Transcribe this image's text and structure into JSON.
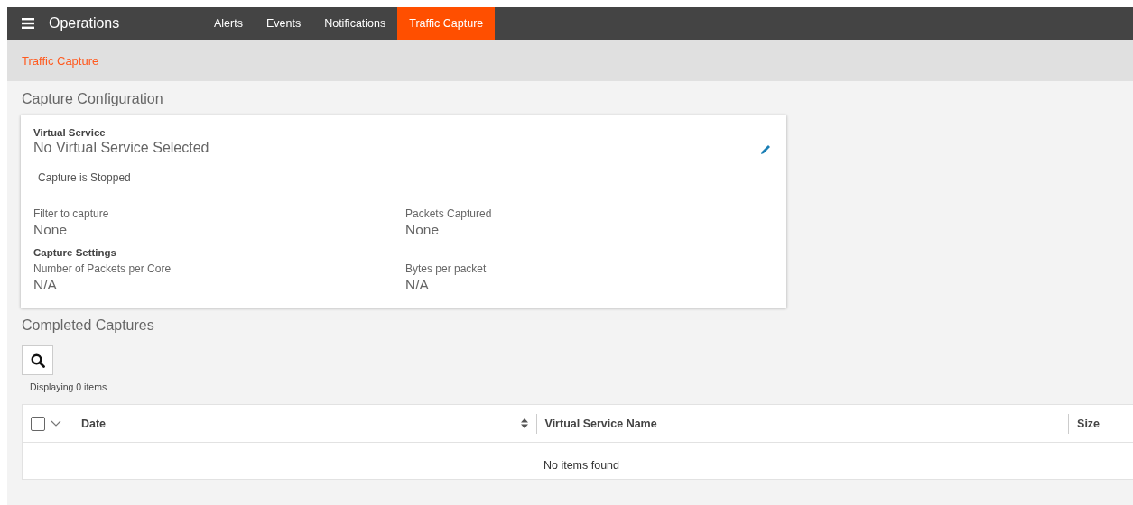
{
  "header": {
    "title": "Operations"
  },
  "tabs": [
    {
      "label": "Alerts",
      "selected": false
    },
    {
      "label": "Events",
      "selected": false
    },
    {
      "label": "Notifications",
      "selected": false
    },
    {
      "label": "Traffic Capture",
      "selected": true
    }
  ],
  "breadcrumb": "Traffic Capture",
  "configuration": {
    "heading": "Capture Configuration",
    "virtual_service": {
      "label": "Virtual Service",
      "value": "No Virtual Service Selected"
    },
    "status": "Capture is Stopped",
    "fields": [
      {
        "label": "Filter to capture",
        "value": "None"
      },
      {
        "label": "Packets Captured",
        "value": "None"
      }
    ],
    "settings_heading": "Capture Settings",
    "settings": [
      {
        "label": "Number of Packets per Core",
        "value": "N/A"
      },
      {
        "label": "Bytes per packet",
        "value": "N/A"
      }
    ]
  },
  "completed": {
    "heading": "Completed Captures",
    "count_text": "Displaying 0 items",
    "table": {
      "select_all_checked": false,
      "columns": [
        {
          "label": "Date",
          "sortable": true
        },
        {
          "label": "Virtual Service Name",
          "sortable": false
        },
        {
          "label": "Size",
          "sortable": false
        }
      ],
      "empty_text": "No items found"
    }
  }
}
